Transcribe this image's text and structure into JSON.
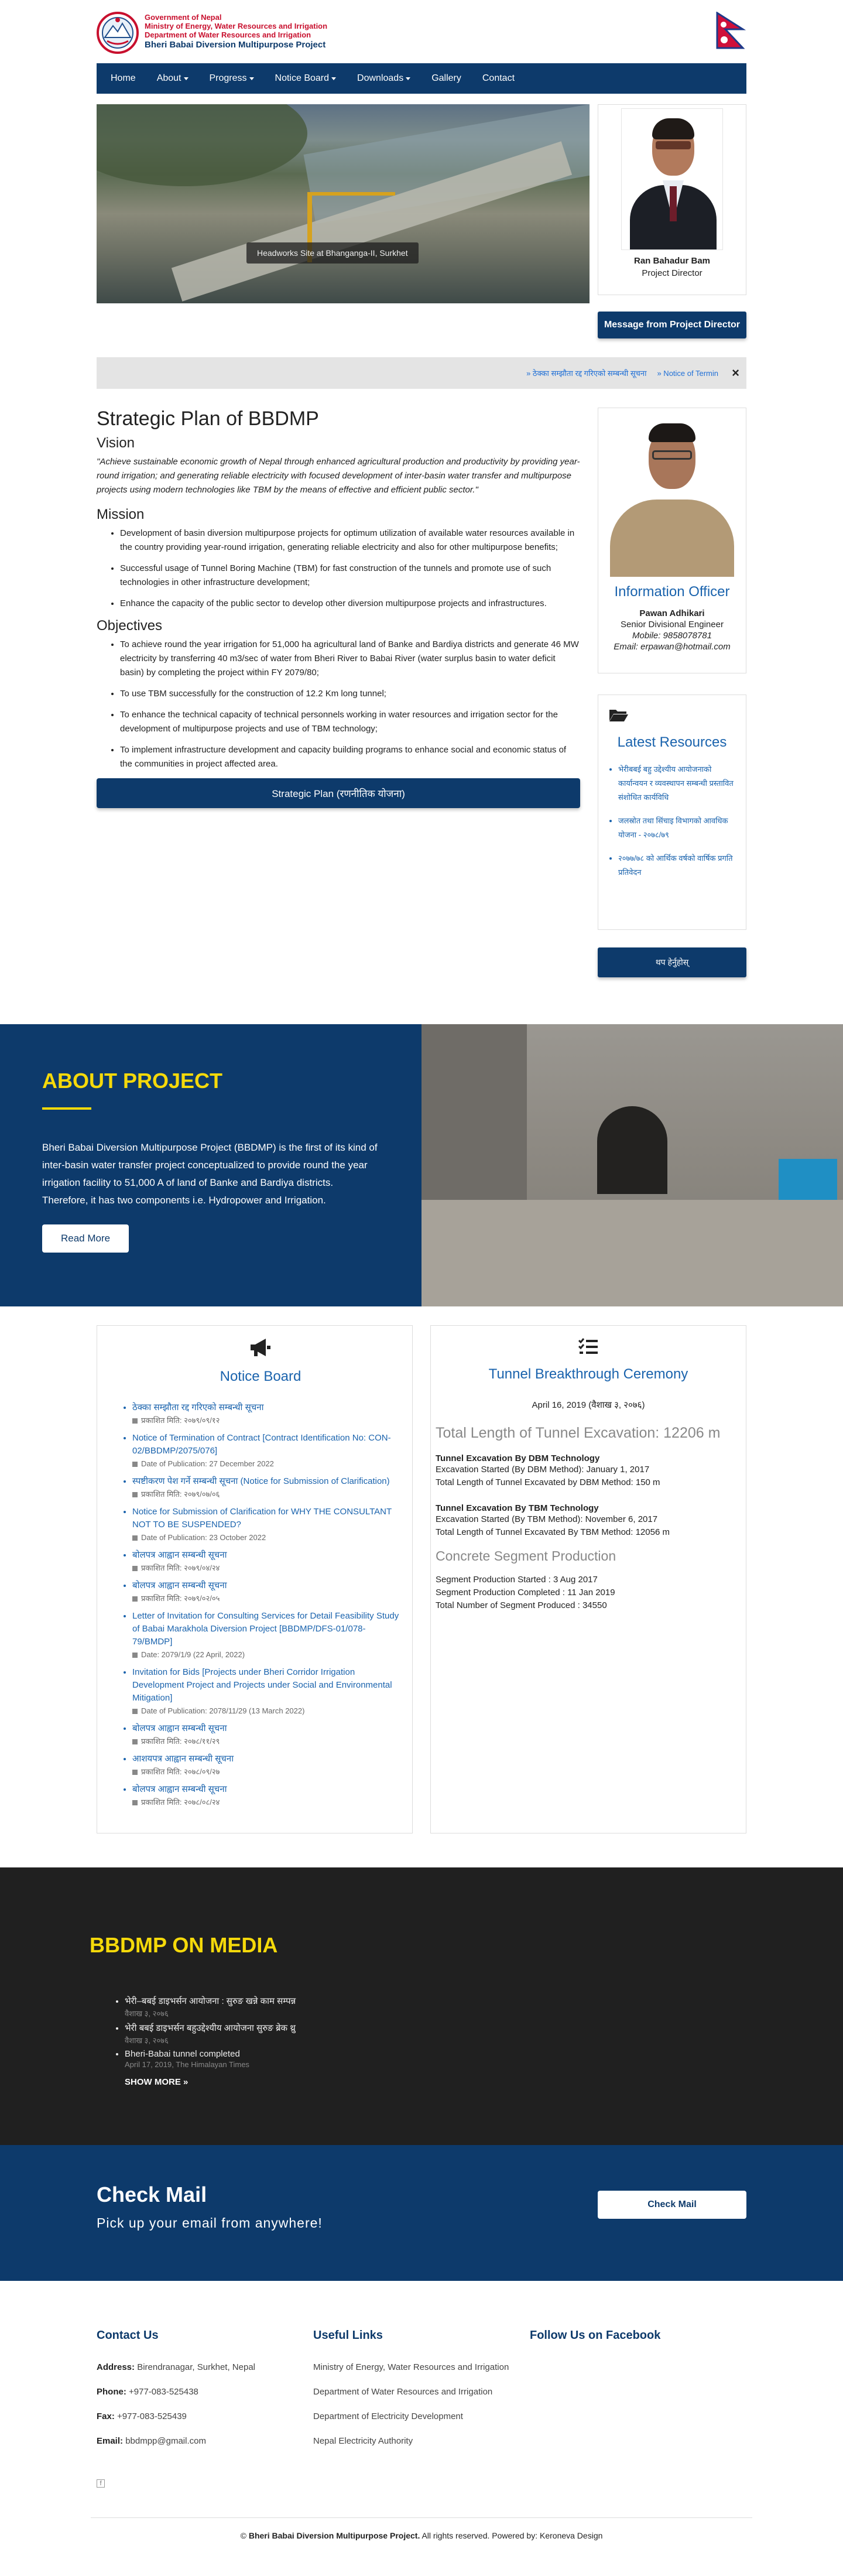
{
  "header": {
    "gov_line1": "Government of Nepal",
    "gov_line2": "Ministry of Energy, Water Resources and Irrigation",
    "gov_line3": "Department of Water Resources and Irrigation",
    "project_name": "Bheri Babai Diversion Multipurpose Project"
  },
  "nav": {
    "items": [
      "Home",
      "About",
      "Progress",
      "Notice Board",
      "Downloads",
      "Gallery",
      "Contact"
    ]
  },
  "hero": {
    "caption": "Headworks Site at Bhanganga-II, Surkhet"
  },
  "project_director": {
    "name": "Ran Bahadur Bam",
    "role": "Project Director",
    "message_button": "Message from Project Director"
  },
  "ticker": {
    "items": [
      "» ठेक्का सम्झौता रद्द गरिएको सम्बन्धी सूचना",
      "» Notice of Termin"
    ],
    "close": "×"
  },
  "strategic_plan": {
    "title": "Strategic Plan of BBDMP",
    "vision_heading": "Vision",
    "vision_text": "\"Achieve sustainable economic growth of Nepal through enhanced agricultural production and productivity by providing year-round irrigation; and generating reliable electricity with focused development of inter-basin water transfer and multipurpose projects using modern technologies like TBM by the means of effective and efficient public sector.\"",
    "mission_heading": "Mission",
    "mission_items": [
      "Development of basin diversion multipurpose projects for optimum utilization of available water resources available in the country providing year-round irrigation, generating reliable electricity and also for other multipurpose benefits;",
      "Successful usage of Tunnel Boring Machine (TBM) for fast construction of the tunnels and promote use of such technologies in other infrastructure development;",
      "Enhance the capacity of the public sector to develop other diversion multipurpose projects and infrastructures."
    ],
    "objectives_heading": "Objectives",
    "objective_items": [
      "To achieve round the year irrigation for 51,000 ha agricultural land of Banke and Bardiya districts and generate 46 MW electricity by transferring 40 m3/sec of water from Bheri River to Babai River (water surplus basin to water deficit basin) by completing the project within FY 2079/80;",
      "To use TBM successfully for the construction of 12.2 Km long tunnel;",
      "To enhance the technical capacity of technical personnels working in water resources and irrigation sector for the development of multipurpose projects and use of TBM technology;",
      "To implement infrastructure development and capacity building programs to enhance social and economic status of the communities in project affected area."
    ],
    "button": "Strategic Plan (रणनीतिक योजना)"
  },
  "information_officer": {
    "heading": "Information Officer",
    "name": "Pawan Adhikari",
    "role": "Senior Divisional Engineer",
    "mobile": "Mobile: 9858078781",
    "email": "Email: erpawan@hotmail.com"
  },
  "latest_resources": {
    "heading": "Latest Resources",
    "items": [
      "भेरीबबई बहु उद्देश्यीय आयोजनाको कार्यान्वयन र व्यवस्थापन सम्बन्धी प्रस्तावित संशोधित कार्यविधि",
      "जलस्रोत तथा सिंचाइ विभागको आवधिक योजना - २०७८/७९",
      "२०७७/७८ को आर्थिक वर्षको वार्षिक प्रगति प्रतिवेदन"
    ],
    "more_button": "थप हेर्नुहोस्"
  },
  "about": {
    "title": "ABOUT PROJECT",
    "text": "Bheri Babai Diversion Multipurpose Project (BBDMP) is the first of its kind of inter-basin water transfer project conceptualized to provide round the year irrigation facility to 51,000 A of land of Banke and Bardiya districts. Therefore, it has two components i.e. Hydropower and Irrigation.",
    "button": "Read More"
  },
  "notice_board": {
    "heading": "Notice Board",
    "items": [
      {
        "title": "ठेक्का सम्झौता रद्द गरिएको सम्बन्धी सूचना",
        "date": "प्रकाशित मिति: २०७९/०९/१२"
      },
      {
        "title": "Notice of Termination of Contract [Contract Identification No: CON-02/BBDMP/2075/076]",
        "date": "Date of Publication: 27 December 2022"
      },
      {
        "title": "स्पष्टीकरण पेश गर्ने सम्बन्धी सूचना (Notice for Submission of Clarification)",
        "date": "प्रकाशित मिति: २०७९/०७/०६"
      },
      {
        "title": "Notice for Submission of Clarification for WHY THE CONSULTANT NOT TO BE SUSPENDED?",
        "date": "Date of Publication: 23 October 2022"
      },
      {
        "title": "बोलपत्र आह्वान सम्बन्धी सूचना",
        "date": "प्रकाशित मिति: २०७९/०४/२४"
      },
      {
        "title": "बोलपत्र आह्वान सम्बन्धी सूचना",
        "date": "प्रकाशित मिति: २०७९/०२/०५"
      },
      {
        "title": "Letter of Invitation for Consulting Services for Detail Feasibility Study of Babai Marakhola Diversion Project [BBDMP/DFS-01/078-79/BMDP]",
        "date": "Date: 2079/1/9 (22 April, 2022)"
      },
      {
        "title": "Invitation for Bids [Projects under Bheri Corridor Irrigation Development Project and Projects under Social and Environmental Mitigation]",
        "date": "Date of Publication: 2078/11/29 (13 March 2022)"
      },
      {
        "title": "बोलपत्र आह्वान सम्बन्धी सूचना",
        "date": "प्रकाशित मिति: २०७८/११/२९"
      },
      {
        "title": "आशयपत्र आह्वान सम्बन्धी सूचना",
        "date": "प्रकाशित मिति: २०७८/०९/२७"
      },
      {
        "title": "बोलपत्र आह्वान सम्बन्धी सूचना",
        "date": "प्रकाशित मिति: २०७८/०८/२४"
      }
    ]
  },
  "tunnel": {
    "heading": "Tunnel Breakthrough Ceremony",
    "date": "April 16, 2019 (वैशाख ३, २०७६)",
    "total_length": "Total Length of Tunnel Excavation: 12206 m",
    "dbm_heading": "Tunnel Excavation By DBM Technology",
    "dbm_lines": [
      "Excavation Started (By DBM Method): January 1, 2017",
      "Total Length of Tunnel Excavated by DBM Method: 150 m"
    ],
    "tbm_heading": "Tunnel Excavation By TBM Technology",
    "tbm_lines": [
      "Excavation Started (By TBM Method): November 6, 2017",
      "Total Length of Tunnel Excavated By TBM Method: 12056 m"
    ],
    "segment_heading": "Concrete Segment Production",
    "segment_lines": [
      "Segment Production Started : 3 Aug 2017",
      "Segment Production Completed : 11 Jan 2019",
      "Total Number of Segment Produced : 34550"
    ]
  },
  "media": {
    "title": "BBDMP ON MEDIA",
    "items": [
      {
        "title": "भेरी–बबई डाइभर्सन आयोजना : सुरुङ खन्ने काम सम्पन्न",
        "date": "वैशाख ३, २०७६"
      },
      {
        "title": "भेरी बबई डाइभर्सन बहुउद्देश्यीय आयोजना सुरुङ ब्रेक थ्रु",
        "date": "वैशाख ३, २०७६"
      },
      {
        "title": "Bheri-Babai tunnel completed",
        "date": "April 17, 2019, The Himalayan Times"
      }
    ],
    "show_more": "SHOW MORE »"
  },
  "mail": {
    "title": "Check Mail",
    "subtitle": "Pick up your email from anywhere!",
    "button": "Check Mail"
  },
  "footer": {
    "contact_heading": "Contact Us",
    "address_label": "Address:",
    "address": "Birendranagar, Surkhet, Nepal",
    "phone_label": "Phone:",
    "phone": "+977-083-525438",
    "fax_label": "Fax:",
    "fax": "+977-083-525439",
    "email_label": "Email:",
    "email": "bbdmpp@gmail.com",
    "links_heading": "Useful Links",
    "links": [
      "Ministry of Energy, Water Resources and Irrigation",
      "Department of Water Resources and Irrigation",
      "Department of Electricity Development",
      "Nepal Electricity Authority"
    ],
    "facebook_heading": "Follow Us on Facebook",
    "facebook_icon": "f",
    "copyright_symbol": "© ",
    "copyright_name": "Bheri Babai Diversion Multipurpose Project.",
    "copyright_rest": " All rights reserved. Powered by: Keroneva Design"
  }
}
